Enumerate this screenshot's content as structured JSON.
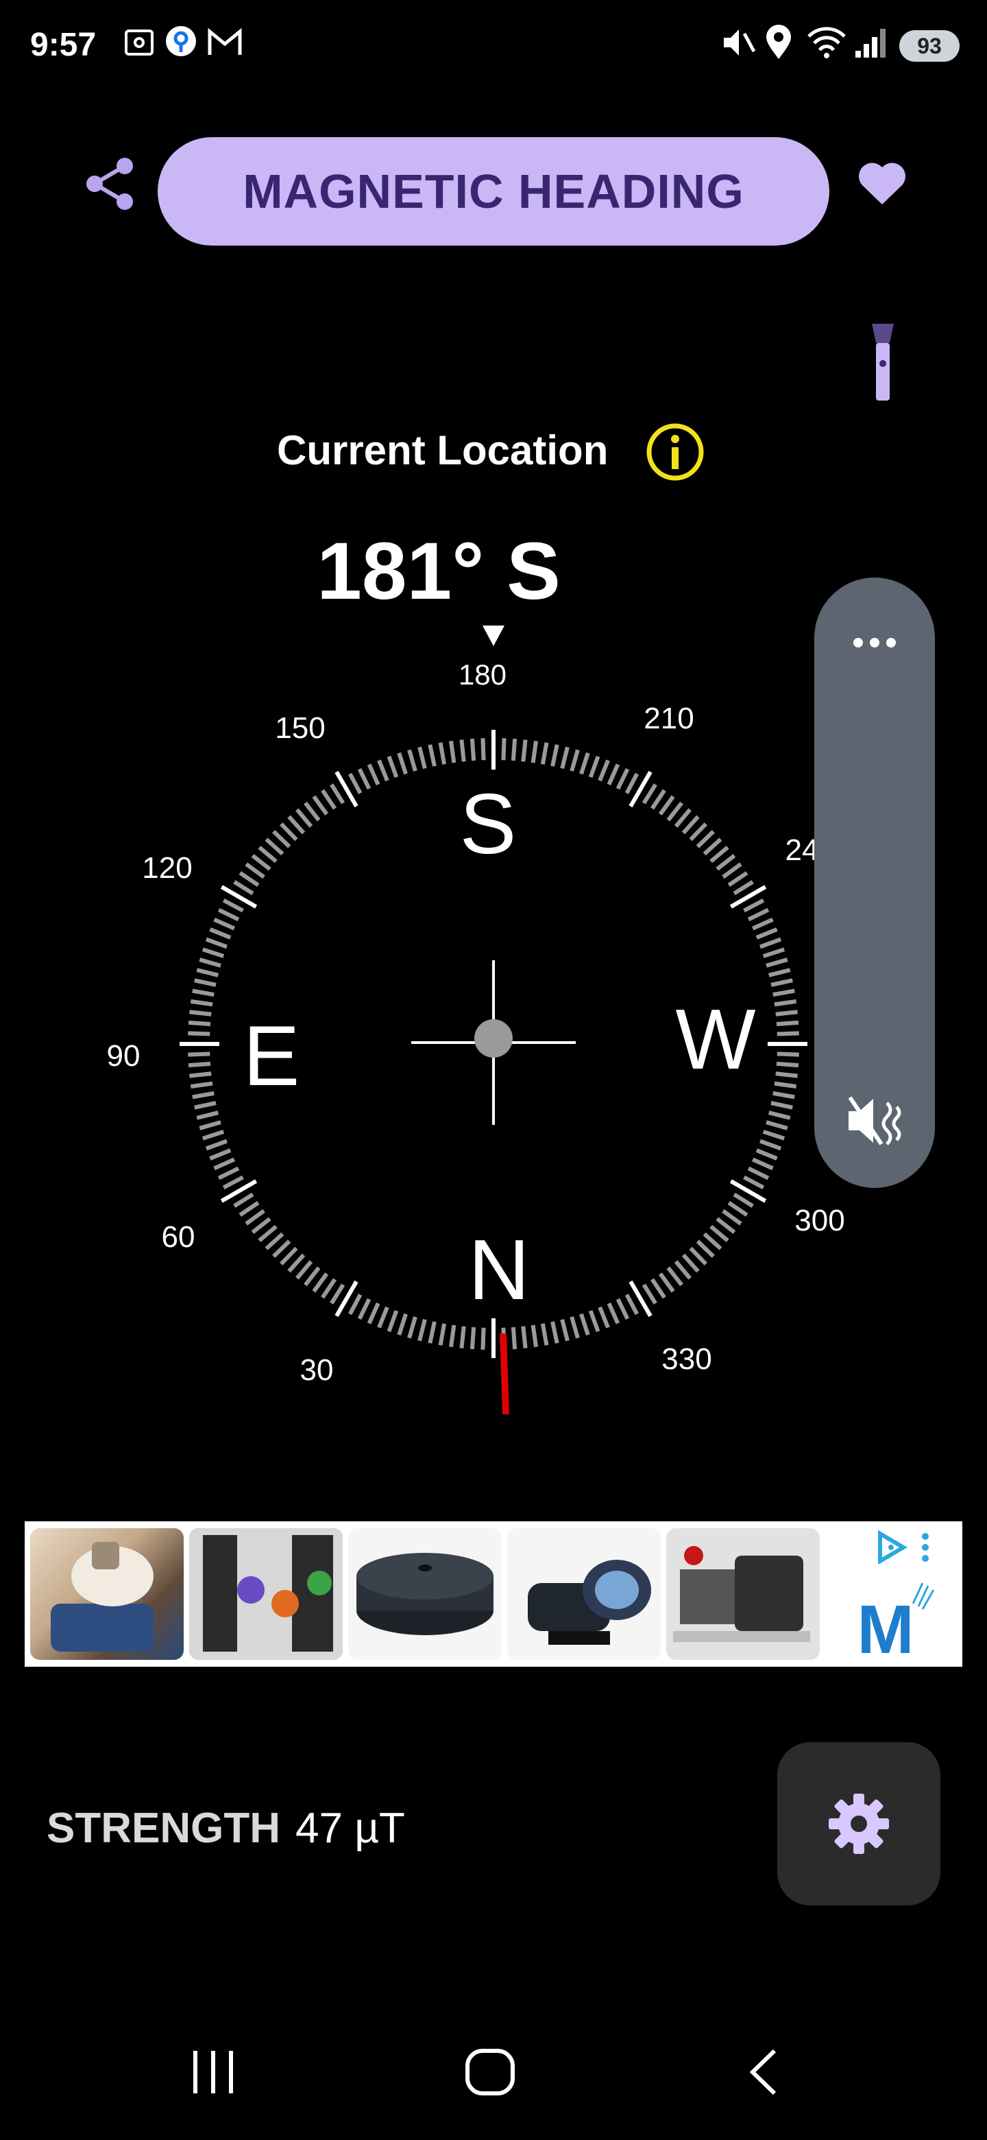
{
  "status_bar": {
    "time": "9:57",
    "battery": "93",
    "left_icons": [
      "screenshot-icon",
      "location-pin-icon",
      "gmail-icon"
    ],
    "right_icons": [
      "mute-vibrate-icon",
      "location-icon",
      "wifi-icon",
      "signal-icon"
    ]
  },
  "header": {
    "title": "MAGNETIC HEADING",
    "accent_color": "#c9b8f5",
    "title_text_color": "#3a2670"
  },
  "location": {
    "label": "Current Location"
  },
  "compass": {
    "heading_readout": "181° S",
    "heading_degrees": 181,
    "pointer_label": "180",
    "degree_labels": [
      "150",
      "210",
      "120",
      "24",
      "90",
      "60",
      "300",
      "30",
      "330"
    ],
    "cardinals": {
      "south": "S",
      "east": "E",
      "west": "W",
      "north": "N"
    },
    "north_marker_color": "#e00000"
  },
  "volume_panel": {
    "more_icon": "more-dots-icon",
    "mute_icon": "vibrate-mute-icon"
  },
  "ad": {
    "brand_mark": "M"
  },
  "footer": {
    "strength_label": "STRENGTH",
    "strength_value": "47 µT"
  },
  "nav_bar": {
    "buttons": [
      "recents",
      "home",
      "back"
    ]
  }
}
